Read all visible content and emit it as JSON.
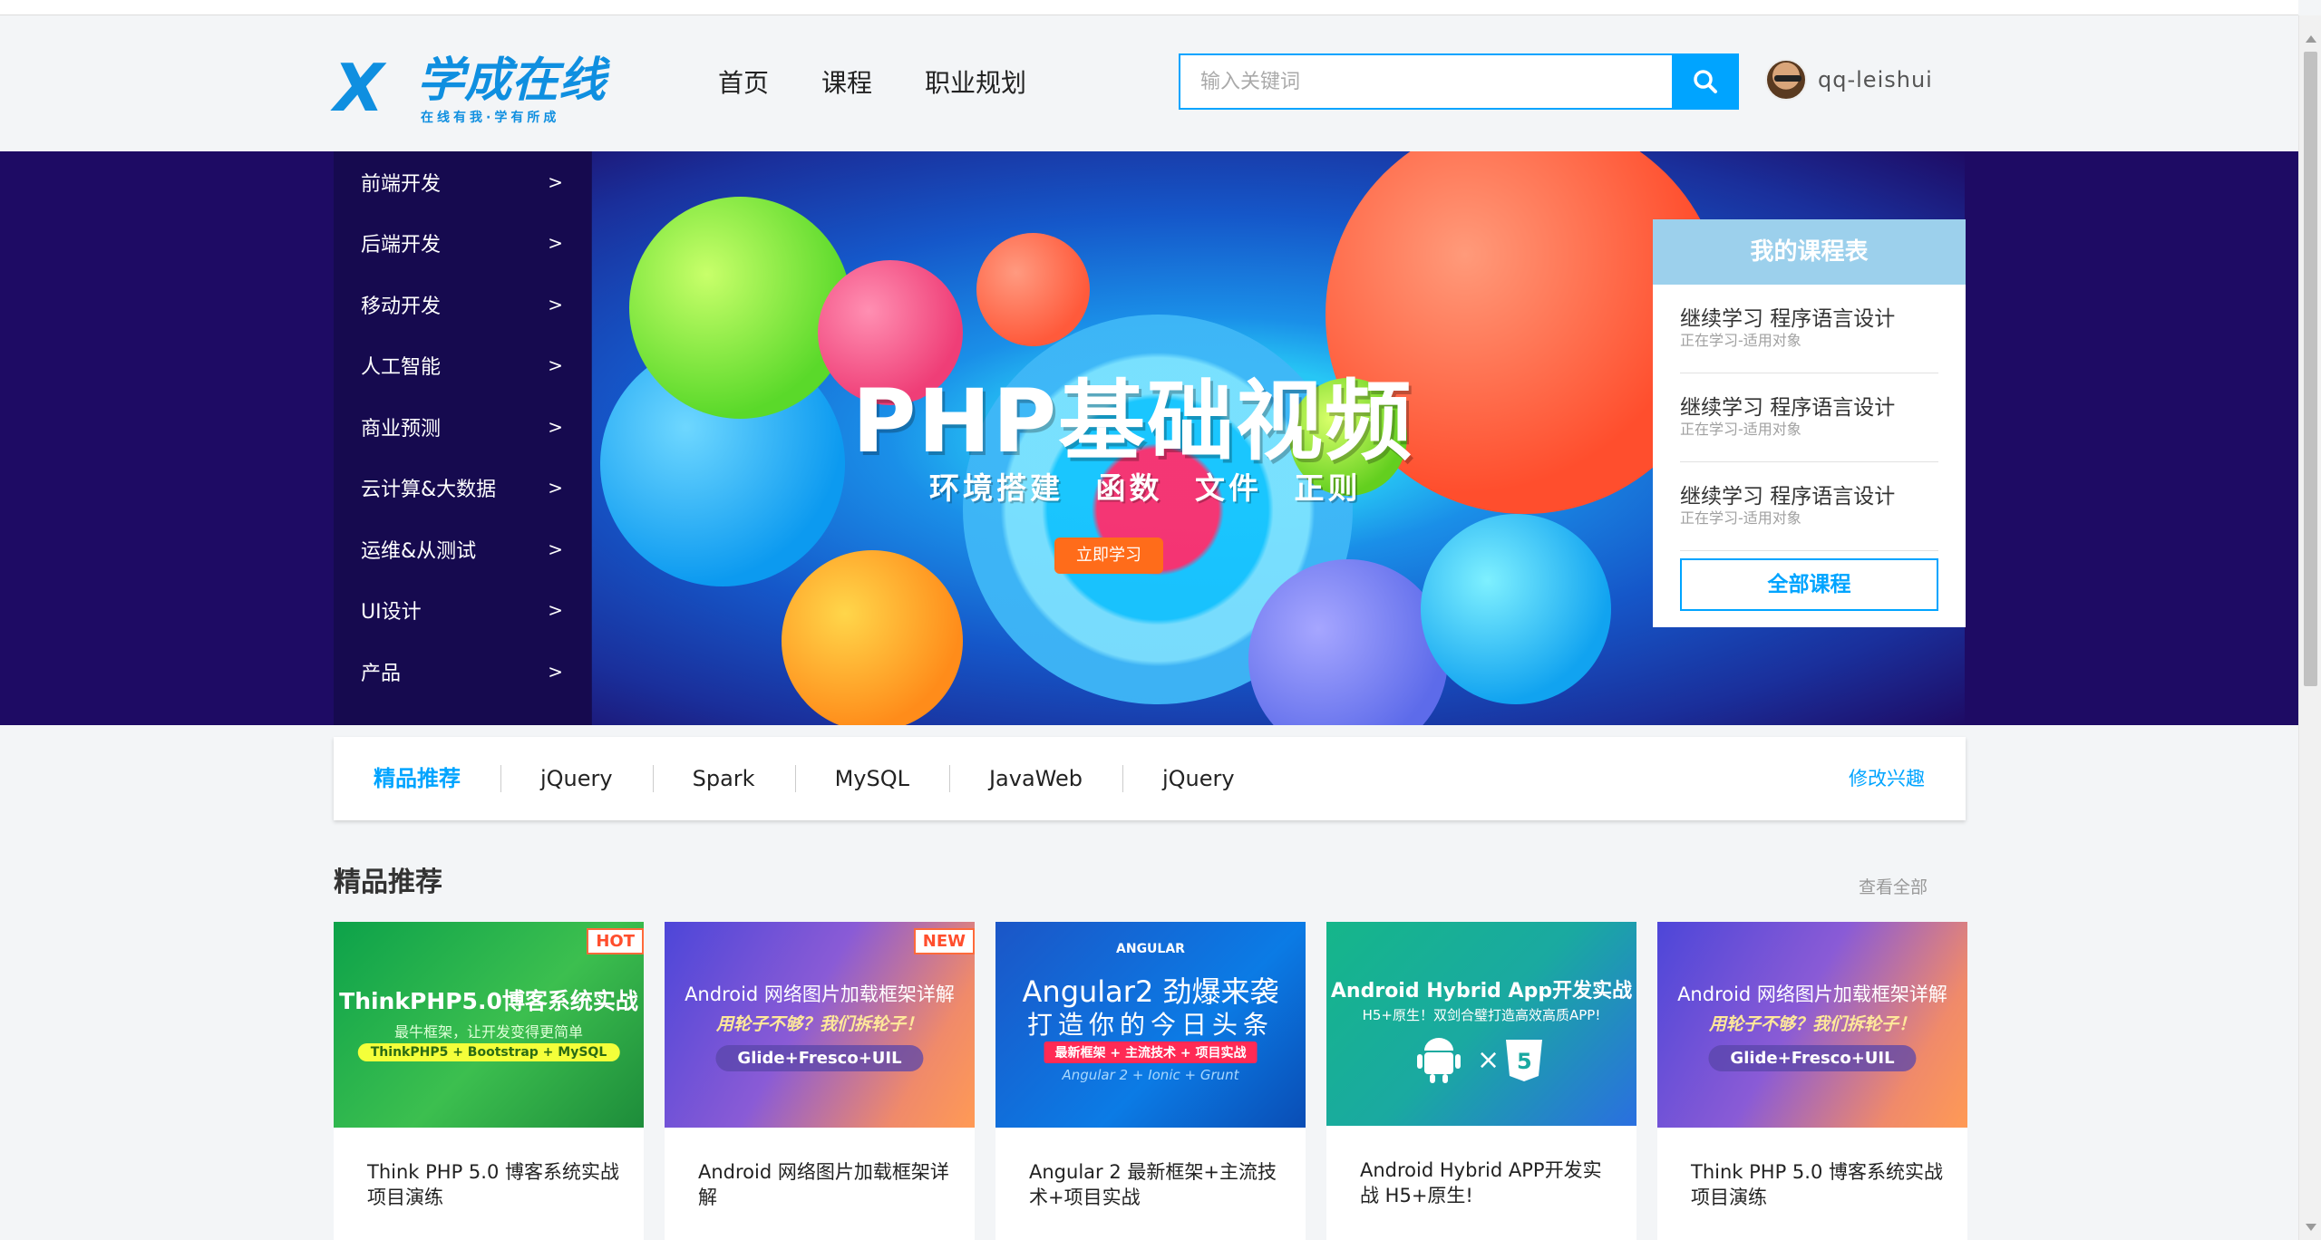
{
  "header": {
    "logo": {
      "mark": "X",
      "name": "学成在线",
      "slogan": "在线有我·学有所成"
    },
    "nav": [
      "首页",
      "课程",
      "职业规划"
    ],
    "search": {
      "placeholder": "输入关键词"
    },
    "user": {
      "name": "qq-leishui"
    }
  },
  "banner": {
    "categories": [
      {
        "label": "前端开发",
        "arrow": ">"
      },
      {
        "label": "后端开发",
        "arrow": ">"
      },
      {
        "label": "移动开发",
        "arrow": ">"
      },
      {
        "label": "人工智能",
        "arrow": ">"
      },
      {
        "label": "商业预测",
        "arrow": ">"
      },
      {
        "label": "云计算&大数据",
        "arrow": ">"
      },
      {
        "label": "运维&从测试",
        "arrow": ">"
      },
      {
        "label": "UI设计",
        "arrow": ">"
      },
      {
        "label": "产品",
        "arrow": ">"
      }
    ],
    "title": "PHP基础视频",
    "subtitle": "环境搭建 函数 文件 正则",
    "cta": "立即学习",
    "my_courses": {
      "title": "我的课程表",
      "items": [
        {
          "title": "继续学习 程序语言设计",
          "desc": "正在学习-适用对象"
        },
        {
          "title": "继续学习 程序语言设计",
          "desc": "正在学习-适用对象"
        },
        {
          "title": "继续学习 程序语言设计",
          "desc": "正在学习-适用对象"
        }
      ],
      "all_button": "全部课程"
    }
  },
  "interest_bar": {
    "tabs": [
      "精品推荐",
      "jQuery",
      "Spark",
      "MySQL",
      "JavaWeb",
      "jQuery"
    ],
    "active_index": 0,
    "edit_link": "修改兴趣"
  },
  "section": {
    "title": "精品推荐",
    "view_all": "查看全部",
    "cards": [
      {
        "badge": "HOT",
        "image_title": "ThinkPHP5.0博客系统实战",
        "image_sub": "最牛框架，让开发变得更简单",
        "image_pill": "ThinkPHP5 + Bootstrap + MySQL",
        "title": "Think PHP 5.0 博客系统实战项目演练"
      },
      {
        "badge": "NEW",
        "image_title": "Android 网络图片加载框架详解",
        "image_sub": "用轮子不够？我们拆轮子！",
        "image_pill": "Glide+Fresco+UIL",
        "title": "Android 网络图片加载框架详解"
      },
      {
        "badge": "",
        "image_brand": "ANGULAR",
        "image_title": "Angular2 劲爆来袭",
        "image_sub": "打造你的今日头条",
        "image_pill": "最新框架 + 主流技术 + 项目实战",
        "image_foot": "Angular 2 + Ionic + Grunt",
        "title": "Angular 2 最新框架+主流技术+项目实战"
      },
      {
        "badge": "",
        "image_title": "Android Hybrid App开发实战",
        "image_sub": "H5+原生！双剑合璧打造高效高质APP!",
        "image_pill": "",
        "title": "Android Hybrid APP开发实战 H5+原生!"
      },
      {
        "badge": "",
        "image_title": "Android 网络图片加载框架详解",
        "image_sub": "用轮子不够？我们拆轮子！",
        "image_pill": "Glide+Fresco+UIL",
        "title": "Think PHP 5.0 博客系统实战项目演练"
      }
    ]
  },
  "colors": {
    "accent": "#00a4ff",
    "banner_bg": "#1e0b64",
    "hot": "#ff4e2d",
    "cta": "#ff6c1a"
  }
}
